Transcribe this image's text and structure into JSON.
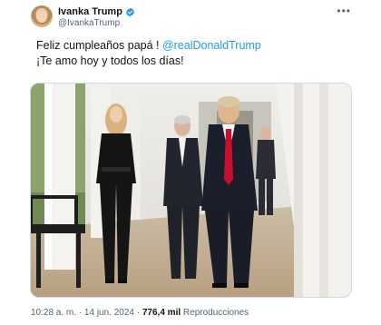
{
  "author": {
    "display_name": "Ivanka Trump",
    "handle": "@IvankaTrump",
    "verified_color": "#1d9bf0",
    "icons": {
      "verified": "verified-badge-icon",
      "more": "more-options-icon"
    }
  },
  "tweet": {
    "line1_text": "Feliz cumpleaños papá ! ",
    "mention": "@realDonaldTrump",
    "line2_text": "¡Te amo hoy y todos los días!"
  },
  "meta": {
    "time": "10:28 a. m.",
    "sep1": " · ",
    "date": "14 jun. 2024",
    "sep2": " · ",
    "views_count": "776,4 mil",
    "views_label": " Reproducciones"
  },
  "colors": {
    "accent": "#1d9bf0",
    "text": "#0f1419",
    "secondary": "#536471"
  }
}
